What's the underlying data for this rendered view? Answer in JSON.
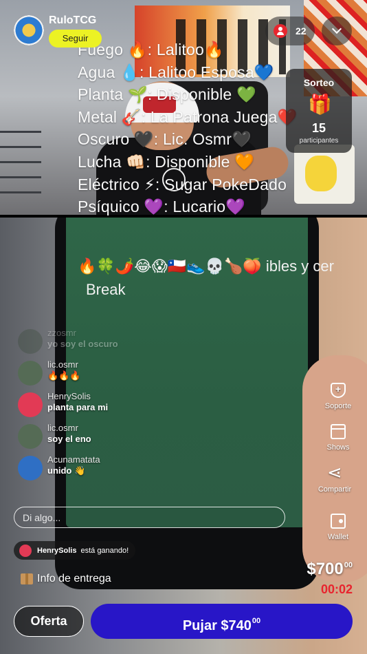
{
  "seller": {
    "name": "RuloTCG",
    "follow_label": "Seguir"
  },
  "viewers": {
    "count": "22"
  },
  "giveaway": {
    "title": "Sorteo",
    "count": "15",
    "subtitle": "participantes",
    "icon": "gift-icon"
  },
  "slots": {
    "lines": [
      "Fuego 🔥: Lalitoo🔥",
      "Agua 💧: Lalitoo Esposa💙",
      "Planta 🌱: Disponible 💚",
      "Metal 🎸: La Patrona Juega❤️",
      "Oscuro 🖤: Lic. Osmr🖤",
      "Lucha 👊🏻:  Disponible 🧡",
      "Eléctrico ⚡: Sugar PokeDado",
      "Psíquico 💜: Lucario💜"
    ],
    "tail": "🔥🍀🌶️😂😱🇨🇱👟💀🍗🍑 ibles y cer",
    "break": "Break"
  },
  "chat": [
    {
      "user": "zzosmr",
      "message": "yo soy el oscuro",
      "avatar_color": "#3a4a3a",
      "faded": true
    },
    {
      "user": "lic.osmr",
      "message": "🔥🔥🔥",
      "avatar_color": "#556b55",
      "faded": false
    },
    {
      "user": "HenrySolis",
      "message": "planta para mi",
      "avatar_color": "#e23a55",
      "faded": false
    },
    {
      "user": "lic.osmr",
      "message": "soy el eno",
      "avatar_color": "#556b55",
      "faded": false
    },
    {
      "user": "Acunamatata",
      "message": "unido 👋",
      "avatar_color": "#2f6fc4",
      "faded": false
    }
  ],
  "side_actions": {
    "support": "Soporte",
    "shows": "Shows",
    "share": "Compartir",
    "wallet": "Wallet"
  },
  "comment": {
    "placeholder": "Di algo..."
  },
  "winner": {
    "name": "HenrySolis",
    "text": "está ganando!"
  },
  "delivery": {
    "label": "Info de entrega"
  },
  "auction": {
    "price": "$700",
    "price_cents": "00",
    "timer": "00:02",
    "offer_label": "Oferta",
    "bid_label": "Pujar $740",
    "bid_cents": "00"
  },
  "colors": {
    "accent_yellow": "#ecf224",
    "bid_blue": "#2816c7",
    "timer_red": "#e8242e",
    "viewer_red": "#e8262e"
  }
}
